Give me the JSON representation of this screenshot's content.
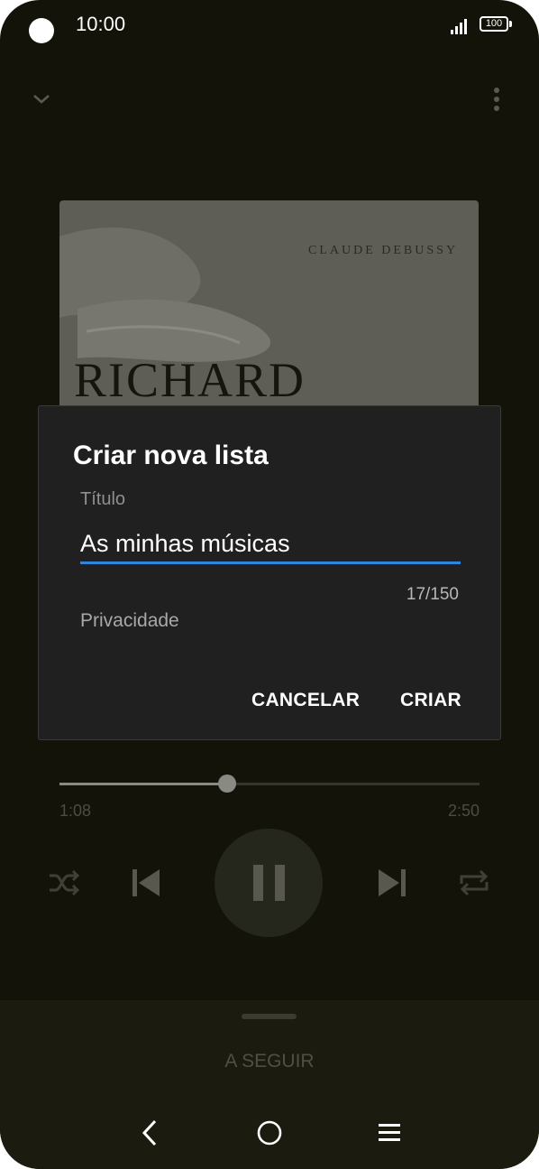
{
  "status_bar": {
    "time": "10:00",
    "battery": "100"
  },
  "album": {
    "composer": "CLAUDE DEBUSSY",
    "title_text": "RICHARD"
  },
  "dialog": {
    "title": "Criar nova lista",
    "title_field_label": "Título",
    "title_field_value": "As minhas músicas",
    "char_counter": "17/150",
    "privacy_label": "Privacidade",
    "cancel_label": "CANCELAR",
    "create_label": "CRIAR"
  },
  "player": {
    "elapsed": "1:08",
    "duration": "2:50",
    "progress_fraction": 0.4
  },
  "bottom_sheet": {
    "up_next_label": "A SEGUIR"
  },
  "colors": {
    "accent": "#2e86d6",
    "background": "#131309",
    "dialog": "#202020"
  },
  "icons": [
    "chevron-down-icon",
    "more-vert-icon",
    "shuffle-icon",
    "skip-previous-icon",
    "pause-icon",
    "skip-next-icon",
    "repeat-icon",
    "back-icon",
    "home-icon",
    "recents-icon"
  ]
}
